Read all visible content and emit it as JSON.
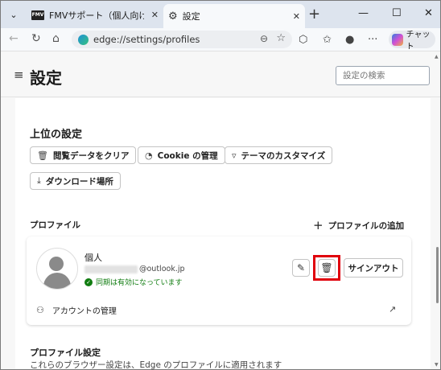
{
  "tabs": [
    {
      "favicon": "FMV",
      "title": "FMVサポート（個人向け富士通"
    },
    {
      "favicon": "gear-icon",
      "title": "設定"
    }
  ],
  "toolbar": {
    "url": "edge://settings/profiles",
    "copilot_label": "チャット"
  },
  "header": {
    "title": "設定",
    "search_placeholder": "設定の検索"
  },
  "top_settings": {
    "title": "上位の設定",
    "buttons": [
      {
        "icon": "trash-icon",
        "label": "閲覧データをクリア"
      },
      {
        "icon": "cookie-icon",
        "label": "Cookie の管理"
      },
      {
        "icon": "brush-icon",
        "label": "テーマのカスタマイズ"
      },
      {
        "icon": "download-icon",
        "label": "ダウンロード場所"
      }
    ]
  },
  "profiles": {
    "title": "プロファイル",
    "add_label": "プロファイルの追加",
    "profile": {
      "name": "個人",
      "email_domain": "@outlook.jp",
      "sync_status": "同期は有効になっています",
      "signout_label": "サインアウト",
      "manage_label": "アカウントの管理"
    }
  },
  "profile_settings": {
    "title": "プロファイル設定",
    "description": "これらのブラウザー設定は、Edge のプロファイルに適用されます"
  },
  "colors": {
    "highlight": "#e0000b",
    "sync_green": "#107c10"
  }
}
